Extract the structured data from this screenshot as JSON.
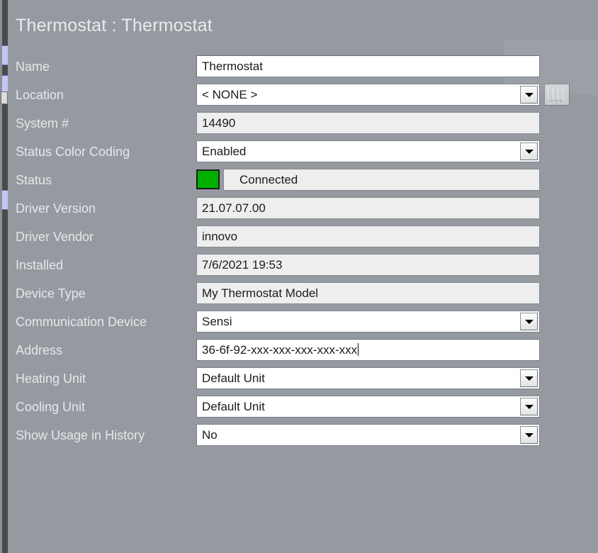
{
  "window": {
    "title": "Thermostat : Thermostat"
  },
  "colors": {
    "background": "#949aa0",
    "label_text": "#e6e8ea",
    "status_green": "#00b000",
    "readonly_field": "#eeeeee",
    "editable_field": "#ffffff",
    "rail_tab": "#c3c8f2"
  },
  "icons": {
    "dropdown_caret": "chevron-down-icon",
    "ellipsis": "...",
    "browse": "ellipsis-button-icon"
  },
  "fields": [
    {
      "label": "Name",
      "name": "name",
      "type": "textbox",
      "value": "Thermostat",
      "readonly": false
    },
    {
      "label": "Location",
      "name": "location",
      "type": "combobox",
      "value": "< NONE >",
      "readonly": false,
      "has_browse_button": true,
      "browse_label": "..."
    },
    {
      "label": "System #",
      "name": "system-number",
      "type": "textbox",
      "value": "14490",
      "readonly": true
    },
    {
      "label": "Status Color Coding",
      "name": "status-color-coding",
      "type": "combobox",
      "value": "Enabled",
      "readonly": false
    },
    {
      "label": "Status",
      "name": "status",
      "type": "status",
      "value": "Connected",
      "swatch_color": "#00b000",
      "readonly": true
    },
    {
      "label": "Driver Version",
      "name": "driver-version",
      "type": "textbox",
      "value": "21.07.07.00",
      "readonly": true
    },
    {
      "label": "Driver Vendor",
      "name": "driver-vendor",
      "type": "textbox",
      "value": "innovo",
      "readonly": true
    },
    {
      "label": "Installed",
      "name": "installed",
      "type": "textbox",
      "value": "7/6/2021 19:53",
      "readonly": true
    },
    {
      "label": "Device Type",
      "name": "device-type",
      "type": "textbox",
      "value": "My Thermostat Model",
      "readonly": true
    },
    {
      "label": "Communication Device",
      "name": "communication-device",
      "type": "combobox",
      "value": "Sensi",
      "readonly": false
    },
    {
      "label": "Address",
      "name": "address",
      "type": "textbox",
      "value": "36-6f-92-xxx-xxx-xxx-xxx-xxx",
      "readonly": false,
      "focused": true
    },
    {
      "label": "Heating Unit",
      "name": "heating-unit",
      "type": "combobox",
      "value": "Default Unit",
      "readonly": false
    },
    {
      "label": "Cooling Unit",
      "name": "cooling-unit",
      "type": "combobox",
      "value": "Default Unit",
      "readonly": false
    },
    {
      "label": "Show Usage in History",
      "name": "show-usage-in-history",
      "type": "combobox",
      "value": "No",
      "readonly": false
    }
  ]
}
